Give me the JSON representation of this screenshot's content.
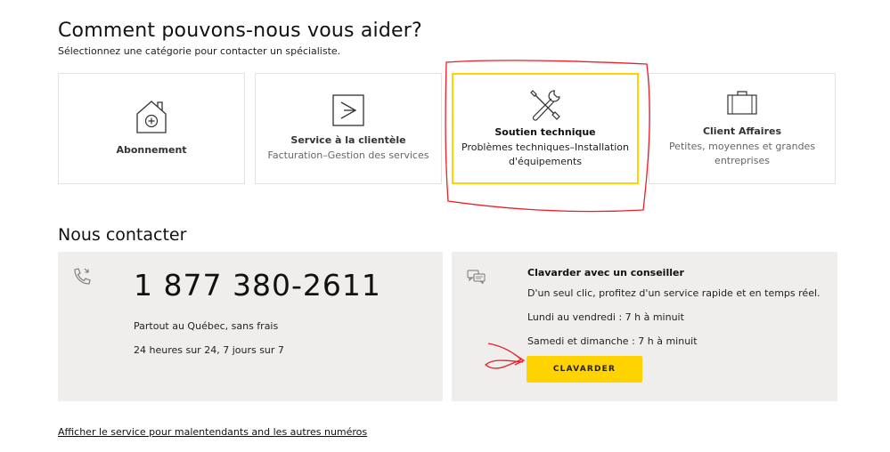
{
  "help": {
    "title": "Comment pouvons-nous vous aider?",
    "subtitle": "Sélectionnez une catégorie pour contacter un spécialiste."
  },
  "categories": [
    {
      "title": "Abonnement",
      "desc": "",
      "icon": "house-plus-icon"
    },
    {
      "title": "Service à la clientèle",
      "desc": "Facturation–Gestion des services",
      "icon": "chevron-box-icon"
    },
    {
      "title": "Soutien technique",
      "desc_line1": "Problèmes techniques–Installation",
      "desc_line2": "d'équipements",
      "icon": "tools-icon",
      "selected": true
    },
    {
      "title": "Client Affaires",
      "desc_line1": "Petites, moyennes et grandes",
      "desc_line2": "entreprises",
      "icon": "briefcase-icon"
    }
  ],
  "contact": {
    "title": "Nous contacter",
    "phone": {
      "number": "1 877 380-2611",
      "line1": "Partout au Québec, sans frais",
      "line2": "24 heures sur 24, 7 jours sur 7",
      "icon": "phone-icon"
    },
    "chat": {
      "title": "Clavarder avec un conseiller",
      "line1": "D'un seul clic, profitez d'un service rapide et en temps réel.",
      "line2": "Lundi au vendredi : 7 h à minuit",
      "line3": "Samedi et dimanche : 7 h à minuit",
      "button": "CLAVARDER",
      "icon": "chat-bubbles-icon"
    }
  },
  "footer": {
    "link": "Afficher le service pour malentendants and les autres numéros"
  },
  "colors": {
    "accent": "#ffd300",
    "panel": "#efeeec",
    "annotation": "#e8202a"
  }
}
